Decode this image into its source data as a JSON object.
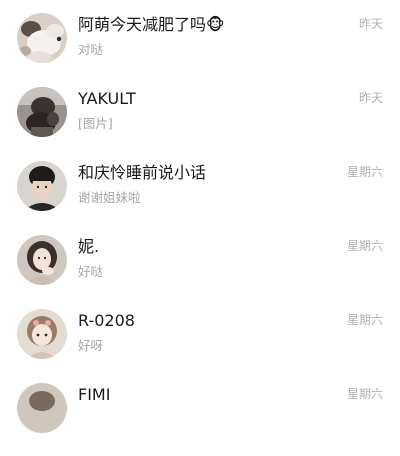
{
  "chats": [
    {
      "name": "阿萌今天减肥了吗🐵",
      "preview": "对哒",
      "time": "昨天",
      "avatar_icon": "white-dog-avatar"
    },
    {
      "name": "YAKULT",
      "preview": "[图片]",
      "time": "昨天",
      "avatar_icon": "dark-dog-photo-avatar"
    },
    {
      "name": "和庆怜睡前说小话",
      "preview": "谢谢姐妹啦",
      "time": "星期六",
      "avatar_icon": "man-portrait-avatar"
    },
    {
      "name": "妮.",
      "preview": "好哒",
      "time": "星期六",
      "avatar_icon": "girl-portrait-avatar"
    },
    {
      "name": "R-0208",
      "preview": "好呀",
      "time": "星期六",
      "avatar_icon": "cartoon-girl-avatar"
    },
    {
      "name": "FIMI",
      "preview": "",
      "time": "星期六",
      "avatar_icon": "photo-avatar"
    }
  ]
}
